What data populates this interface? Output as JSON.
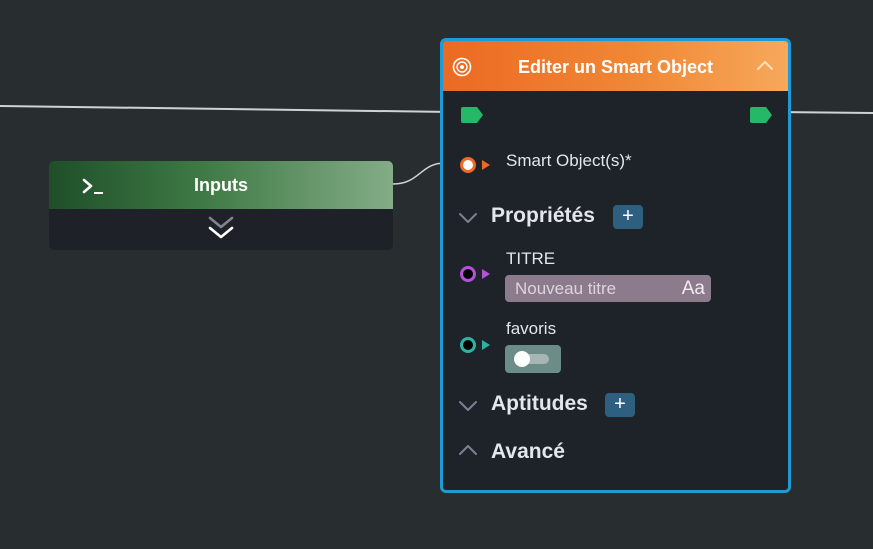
{
  "inputs_node": {
    "title": "Inputs",
    "icon": "terminal-icon",
    "expand_icon": "double-chevron-down-icon",
    "header_colors": [
      "#1f4f29",
      "#84ac87"
    ]
  },
  "smart_node": {
    "title": "Editer un Smart Object",
    "icon": "target-icon",
    "collapse_icon": "chevron-up-icon",
    "header_colors": [
      "#ec6a23",
      "#f7a85a"
    ],
    "border_color": "#1e9bd6",
    "input_smart_objects": {
      "label": "Smart Object(s)*",
      "port_color": "#ec6a23"
    },
    "sections": {
      "proprietes": {
        "label": "Propriétés",
        "add_label": "+"
      },
      "aptitudes": {
        "label": "Aptitudes",
        "add_label": "+"
      },
      "avance": {
        "label": "Avancé"
      }
    },
    "props": {
      "titre": {
        "label": "TITRE",
        "placeholder": "Nouveau titre",
        "type_icon": "Aa",
        "port_color": "#b452d6"
      },
      "favoris": {
        "label": "favoris",
        "value": false,
        "port_color": "#2fb2a5"
      }
    }
  },
  "colors": {
    "exec_port": "#25b868",
    "wire": "#cfd3d6"
  }
}
